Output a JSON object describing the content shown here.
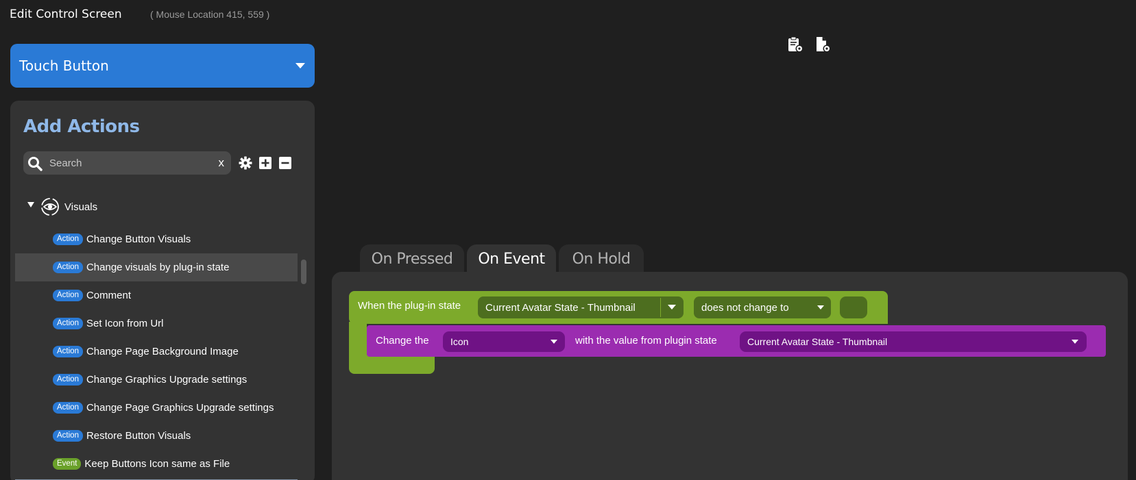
{
  "header": {
    "title": "Edit Control Screen",
    "mouse_location": "( Mouse Location 415, 559 )"
  },
  "control_type": {
    "selected": "Touch Button"
  },
  "actions_panel": {
    "heading": "Add Actions",
    "search": {
      "placeholder": "Search",
      "value": "",
      "clear_label": "x"
    },
    "tools": [
      "gear-icon",
      "plus-square-icon",
      "minus-square-icon"
    ],
    "category": {
      "label": "Visuals",
      "expanded": true
    },
    "items": [
      {
        "badge": "Action",
        "label": "Change Button Visuals"
      },
      {
        "badge": "Action",
        "label": "Change visuals by plug-in state",
        "selected": true
      },
      {
        "badge": "Action",
        "label": "Comment"
      },
      {
        "badge": "Action",
        "label": "Set Icon from Url"
      },
      {
        "badge": "Action",
        "label": "Change Page Background Image"
      },
      {
        "badge": "Action",
        "label": "Change Graphics Upgrade settings"
      },
      {
        "badge": "Action",
        "label": "Change Page Graphics Upgrade settings"
      },
      {
        "badge": "Action",
        "label": "Restore Button Visuals"
      },
      {
        "badge": "Event",
        "label": "Keep Buttons Icon same as File"
      }
    ]
  },
  "tabs": [
    {
      "label": "On Pressed",
      "active": false
    },
    {
      "label": "On Event",
      "active": true
    },
    {
      "label": "On Hold",
      "active": false
    }
  ],
  "event_block": {
    "prefix": "When the plug-in state",
    "state_value": "Current Avatar State - Thumbnail",
    "condition_value": "does not change to",
    "compare_value": ""
  },
  "action_block": {
    "prefix": "Change the",
    "property_value": "Icon",
    "middle_text": "with the value from plugin state",
    "state_value": "Current Avatar State - Thumbnail"
  },
  "colors": {
    "background": "#1f1f1f",
    "panel": "#333333",
    "accent_blue": "#2a7ad6",
    "heading_blue": "#8fb8e8",
    "event_green": "#7daa2b",
    "event_green_dark": "#4d6e1f",
    "action_purple": "#9b2cb0",
    "action_purple_dark": "#6f1285",
    "badge_event_green": "#6aa12a"
  }
}
